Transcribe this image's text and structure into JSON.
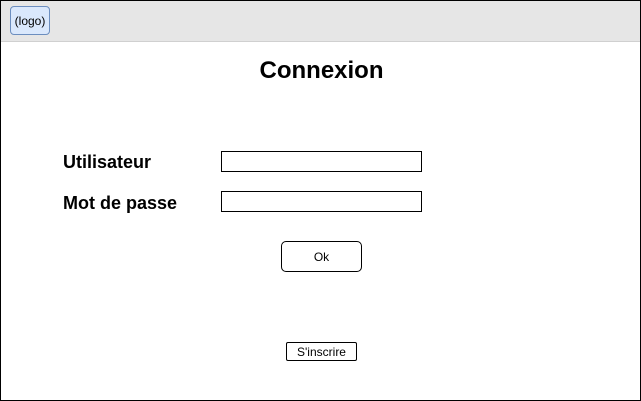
{
  "header": {
    "logo_text": "(logo)"
  },
  "login": {
    "title": "Connexion",
    "username_label": "Utilisateur",
    "username_value": "",
    "password_label": "Mot de passe",
    "password_value": "",
    "ok_label": "Ok",
    "register_label": "S'inscrire"
  },
  "colors": {
    "topbar_bg": "#e6e6e6",
    "logo_bg": "#dae8fc",
    "logo_border": "#6c8ebf"
  }
}
